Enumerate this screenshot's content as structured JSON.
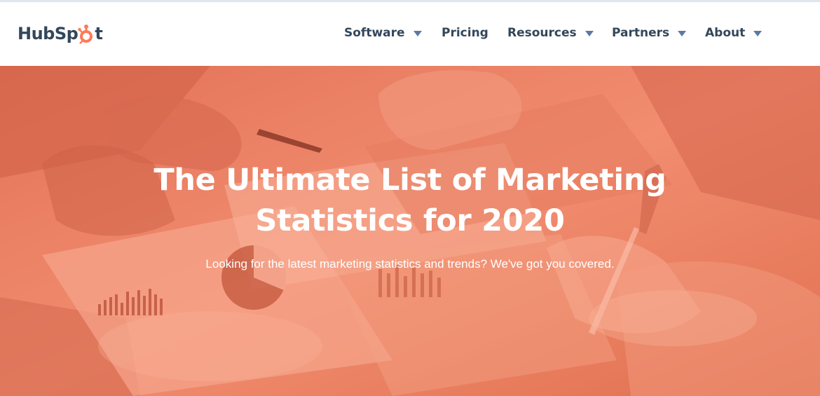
{
  "header": {
    "logo_text_left": "HubSp",
    "logo_text_right": "t",
    "nav": [
      {
        "label": "Software",
        "has_dropdown": true
      },
      {
        "label": "Pricing",
        "has_dropdown": false
      },
      {
        "label": "Resources",
        "has_dropdown": true
      },
      {
        "label": "Partners",
        "has_dropdown": true
      },
      {
        "label": "About",
        "has_dropdown": true
      }
    ]
  },
  "hero": {
    "title_line1": "The Ultimate List of Marketing",
    "title_line2": "Statistics for 2020",
    "subtitle": "Looking for the latest marketing statistics and trends? We've got you covered."
  },
  "colors": {
    "brand_orange": "#ff7a59",
    "hero_overlay": "#f0866a",
    "nav_text": "#33475b",
    "caret": "#5c7aa0"
  }
}
